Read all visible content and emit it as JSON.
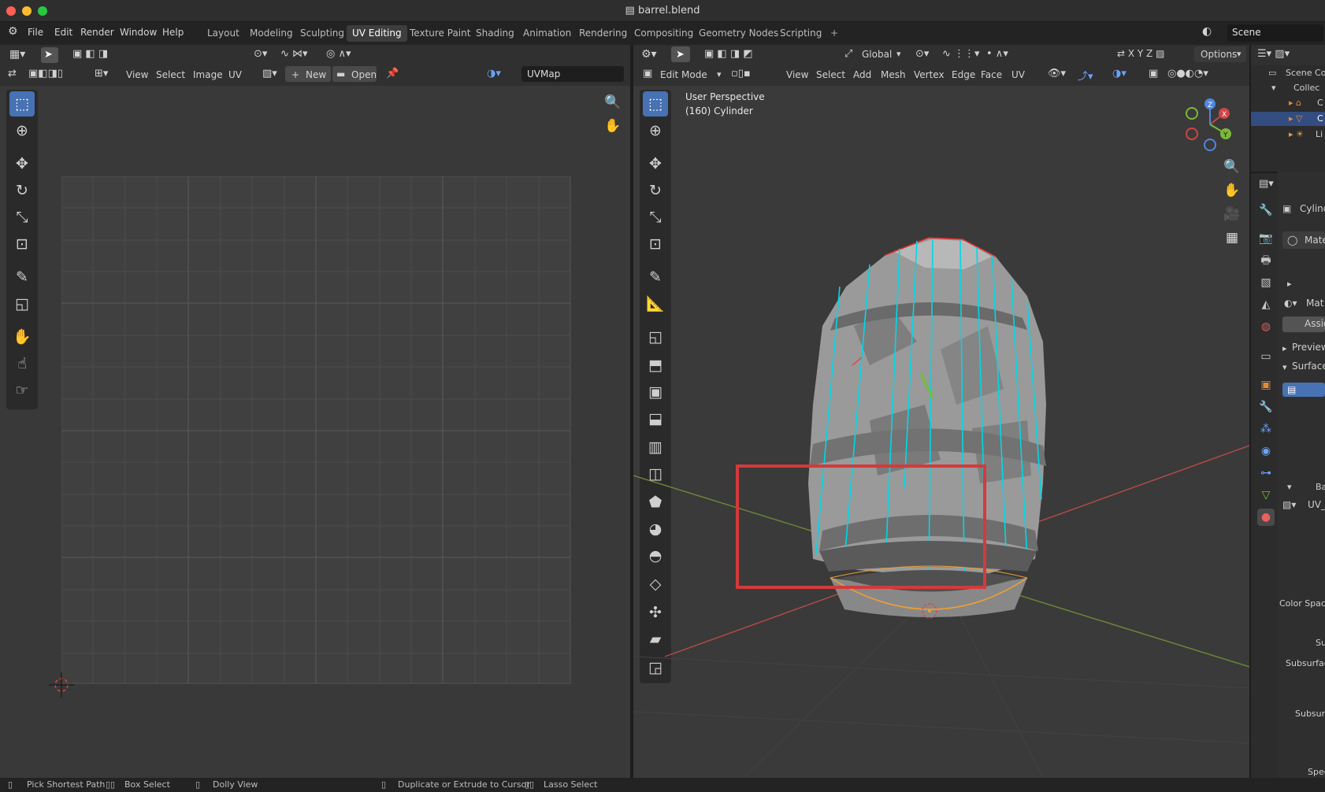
{
  "window": {
    "title": "barrel.blend"
  },
  "menu": [
    "File",
    "Edit",
    "Render",
    "Window",
    "Help"
  ],
  "workspaces": [
    "Layout",
    "Modeling",
    "Sculpting",
    "UV Editing",
    "Texture Paint",
    "Shading",
    "Animation",
    "Rendering",
    "Compositing",
    "Geometry Nodes",
    "Scripting"
  ],
  "active_workspace": "UV Editing",
  "scene_name": "Scene",
  "uv_editor": {
    "menus": [
      "View",
      "Select",
      "Image",
      "UV"
    ],
    "new_label": "New",
    "open_label": "Open",
    "uvmap_field": "UVMap"
  },
  "viewport": {
    "transform_orientation": "Global",
    "options_label": "Options",
    "mode": "Edit Mode",
    "menus": [
      "View",
      "Select",
      "Add",
      "Mesh",
      "Vertex",
      "Edge",
      "Face",
      "UV"
    ],
    "info_line1": "User Perspective",
    "info_line2": "(160) Cylinder",
    "gizmo_axes": [
      "X",
      "Y",
      "Z"
    ]
  },
  "outliner": {
    "scene_collection": "Scene Col",
    "collection": "Collec",
    "items": [
      "C",
      "C",
      "Li"
    ]
  },
  "properties": {
    "object_name": "Cylind",
    "material_slot": "Mate",
    "material_field": "Mat",
    "assign": "Assig",
    "preview": "Preview",
    "surface": "Surface",
    "base_color_short": "Ba",
    "uv_field": "UV_",
    "color_space": "Color Space",
    "su": "Su",
    "subsurface1": "Subsurfac",
    "subsurface2": "Subsurfa",
    "spec": "Spec"
  },
  "status_bar": [
    "Pick Shortest Path",
    "Box Select",
    "Dolly View",
    "Duplicate or Extrude to Cursor",
    "Lasso Select"
  ],
  "colors": {
    "accent": "#4772b3",
    "highlight_box": "#d43a3a",
    "edge_select": "#00d8e8",
    "bg": "#393939"
  }
}
